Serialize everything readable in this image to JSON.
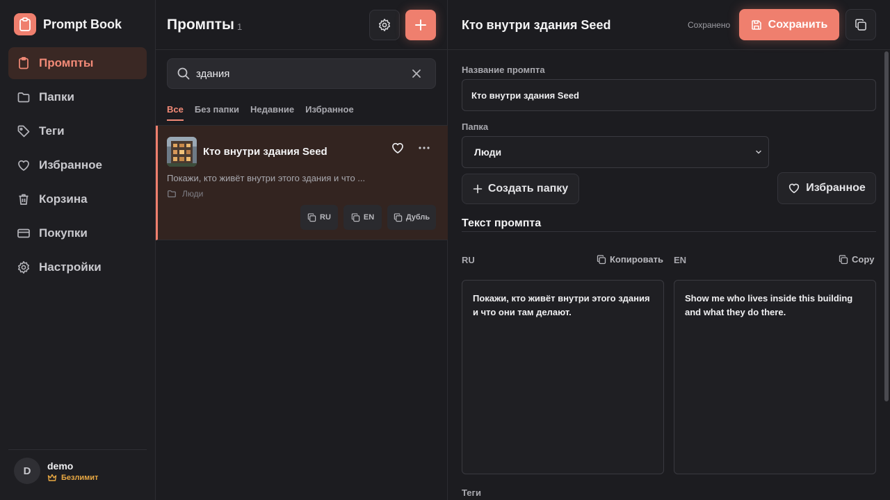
{
  "app": {
    "name": "Prompt Book",
    "colors": {
      "accent": "#ef7f6e",
      "bg": "#1c1c20",
      "active_nav_bg": "#3a2824",
      "plan": "#e8a843"
    }
  },
  "sidebar": {
    "items": [
      {
        "label": "Промпты",
        "icon": "clipboard-icon",
        "active": true
      },
      {
        "label": "Папки",
        "icon": "folder-icon",
        "active": false
      },
      {
        "label": "Теги",
        "icon": "tag-icon",
        "active": false
      },
      {
        "label": "Избранное",
        "icon": "heart-icon",
        "active": false
      },
      {
        "label": "Корзина",
        "icon": "trash-icon",
        "active": false
      },
      {
        "label": "Покупки",
        "icon": "credit-card-icon",
        "active": false
      },
      {
        "label": "Настройки",
        "icon": "gear-icon",
        "active": false
      }
    ],
    "user": {
      "initial": "D",
      "name": "demo",
      "plan": "Безлимит",
      "plan_icon": "crown-icon"
    }
  },
  "list": {
    "title": "Промпты",
    "count": "1",
    "search": {
      "value": "здания",
      "placeholder": ""
    },
    "filters": [
      {
        "label": "Все",
        "active": true
      },
      {
        "label": "Без папки",
        "active": false
      },
      {
        "label": "Недавние",
        "active": false
      },
      {
        "label": "Избранное",
        "active": false
      }
    ],
    "items": [
      {
        "title": "Кто внутри здания Seed",
        "description": "Покажи, кто живёт внутри этого здания и что ...",
        "folder": "Люди",
        "actions": {
          "ru": "RU",
          "en": "EN",
          "duplicate": "Дубль"
        }
      }
    ]
  },
  "editor": {
    "title": "Кто внутри здания Seed",
    "status": "Сохранено",
    "save_label": "Сохранить",
    "name_label": "Название промпта",
    "name_value": "Кто внутри здания Seed",
    "folder_label": "Папка",
    "folder_value": "Люди",
    "create_folder_label": "Создать папку",
    "favorite_label": "Избранное",
    "text_section_title": "Текст промпта",
    "ru": {
      "label": "RU",
      "copy_label": "Копировать",
      "text": "Покажи, кто живёт внутри этого здания и что они там делают."
    },
    "en": {
      "label": "EN",
      "copy_label": "Copy",
      "text": "Show me who lives inside this building and what they do there."
    },
    "tags_label": "Теги"
  }
}
